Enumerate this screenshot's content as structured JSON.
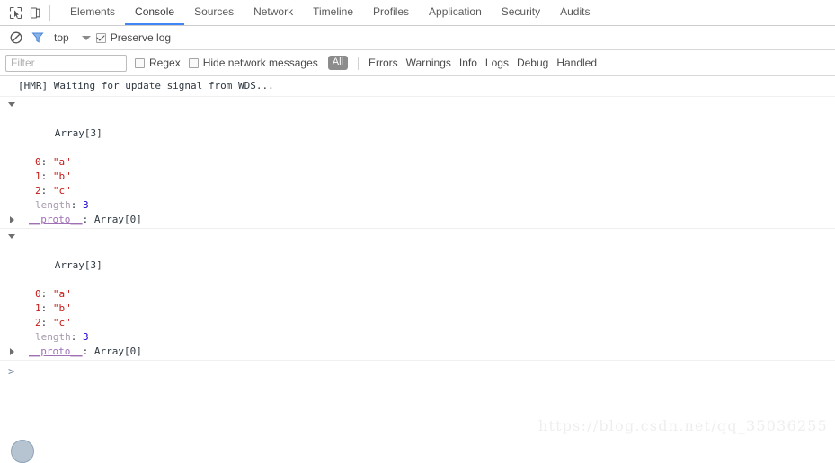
{
  "toolbar": {
    "inspect_icon": "inspect-cursor-icon",
    "device_icon": "device-toolbar-icon",
    "tabs": [
      {
        "label": "Elements",
        "active": false
      },
      {
        "label": "Console",
        "active": true
      },
      {
        "label": "Sources",
        "active": false
      },
      {
        "label": "Network",
        "active": false
      },
      {
        "label": "Timeline",
        "active": false
      },
      {
        "label": "Profiles",
        "active": false
      },
      {
        "label": "Application",
        "active": false
      },
      {
        "label": "Security",
        "active": false
      },
      {
        "label": "Audits",
        "active": false
      }
    ]
  },
  "subbar": {
    "clear_icon": "clear-console-icon",
    "filter_icon": "funnel-filter-icon",
    "context": "top",
    "preserve_log_label": "Preserve log",
    "preserve_log_checked": true
  },
  "filterbar": {
    "filter_placeholder": "Filter",
    "filter_value": "",
    "regex_label": "Regex",
    "regex_checked": false,
    "hide_network_label": "Hide network messages",
    "hide_network_checked": false,
    "level_all": "All",
    "levels": [
      "Errors",
      "Warnings",
      "Info",
      "Logs",
      "Debug",
      "Handled"
    ]
  },
  "console": {
    "hmr_message": "[HMR] Waiting for update signal from WDS...",
    "arrays": [
      {
        "header": "Array[3]",
        "expanded": true,
        "props": [
          {
            "key": "0",
            "key_type": "index",
            "value": "\"a\"",
            "value_type": "string"
          },
          {
            "key": "1",
            "key_type": "index",
            "value": "\"b\"",
            "value_type": "string"
          },
          {
            "key": "2",
            "key_type": "index",
            "value": "\"c\"",
            "value_type": "string"
          },
          {
            "key": "length",
            "key_type": "name",
            "value": "3",
            "value_type": "number"
          }
        ],
        "proto_key": "__proto__",
        "proto_value": "Array[0]"
      },
      {
        "header": "Array[3]",
        "expanded": true,
        "props": [
          {
            "key": "0",
            "key_type": "index",
            "value": "\"a\"",
            "value_type": "string"
          },
          {
            "key": "1",
            "key_type": "index",
            "value": "\"b\"",
            "value_type": "string"
          },
          {
            "key": "2",
            "key_type": "index",
            "value": "\"c\"",
            "value_type": "string"
          },
          {
            "key": "length",
            "key_type": "name",
            "value": "3",
            "value_type": "number"
          }
        ],
        "proto_key": "__proto__",
        "proto_value": "Array[0]"
      }
    ],
    "prompt_symbol": ">",
    "prompt_value": ""
  },
  "watermark": {
    "text": "https://blog.csdn.net/qq_35036255"
  },
  "colors": {
    "accent": "#4285f4",
    "string": "#c41a16",
    "number": "#1c00cf",
    "proto_link": "#a070b5",
    "prop_name": "#a59aad",
    "level_badge": "#8c8c8c"
  }
}
